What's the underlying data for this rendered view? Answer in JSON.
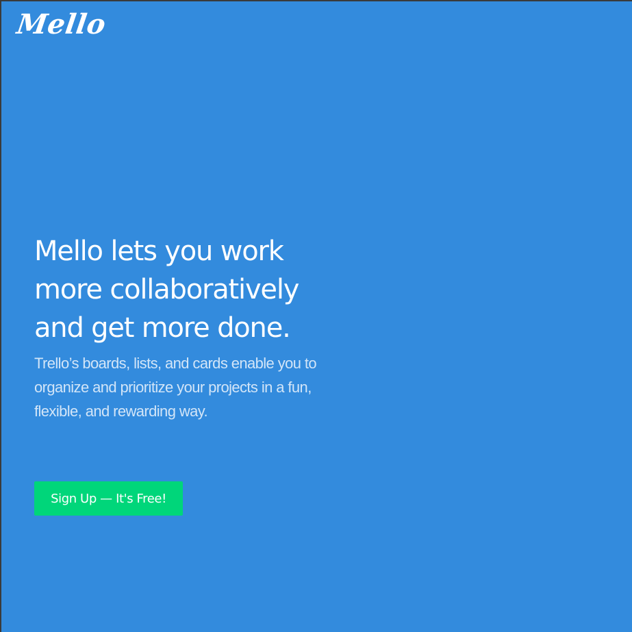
{
  "brand": {
    "logo_text": "Mello"
  },
  "hero": {
    "headline": "Mello lets you work more collaboratively and get more done.",
    "subtext": "Trello’s boards, lists, and cards enable you to organize and prioritize your projects in a fun, flexible, and rewarding way."
  },
  "cta": {
    "label": "Sign Up — It's Free!"
  },
  "colors": {
    "background": "#338bdd",
    "cta_background": "#00d67a",
    "text": "#ffffff"
  }
}
